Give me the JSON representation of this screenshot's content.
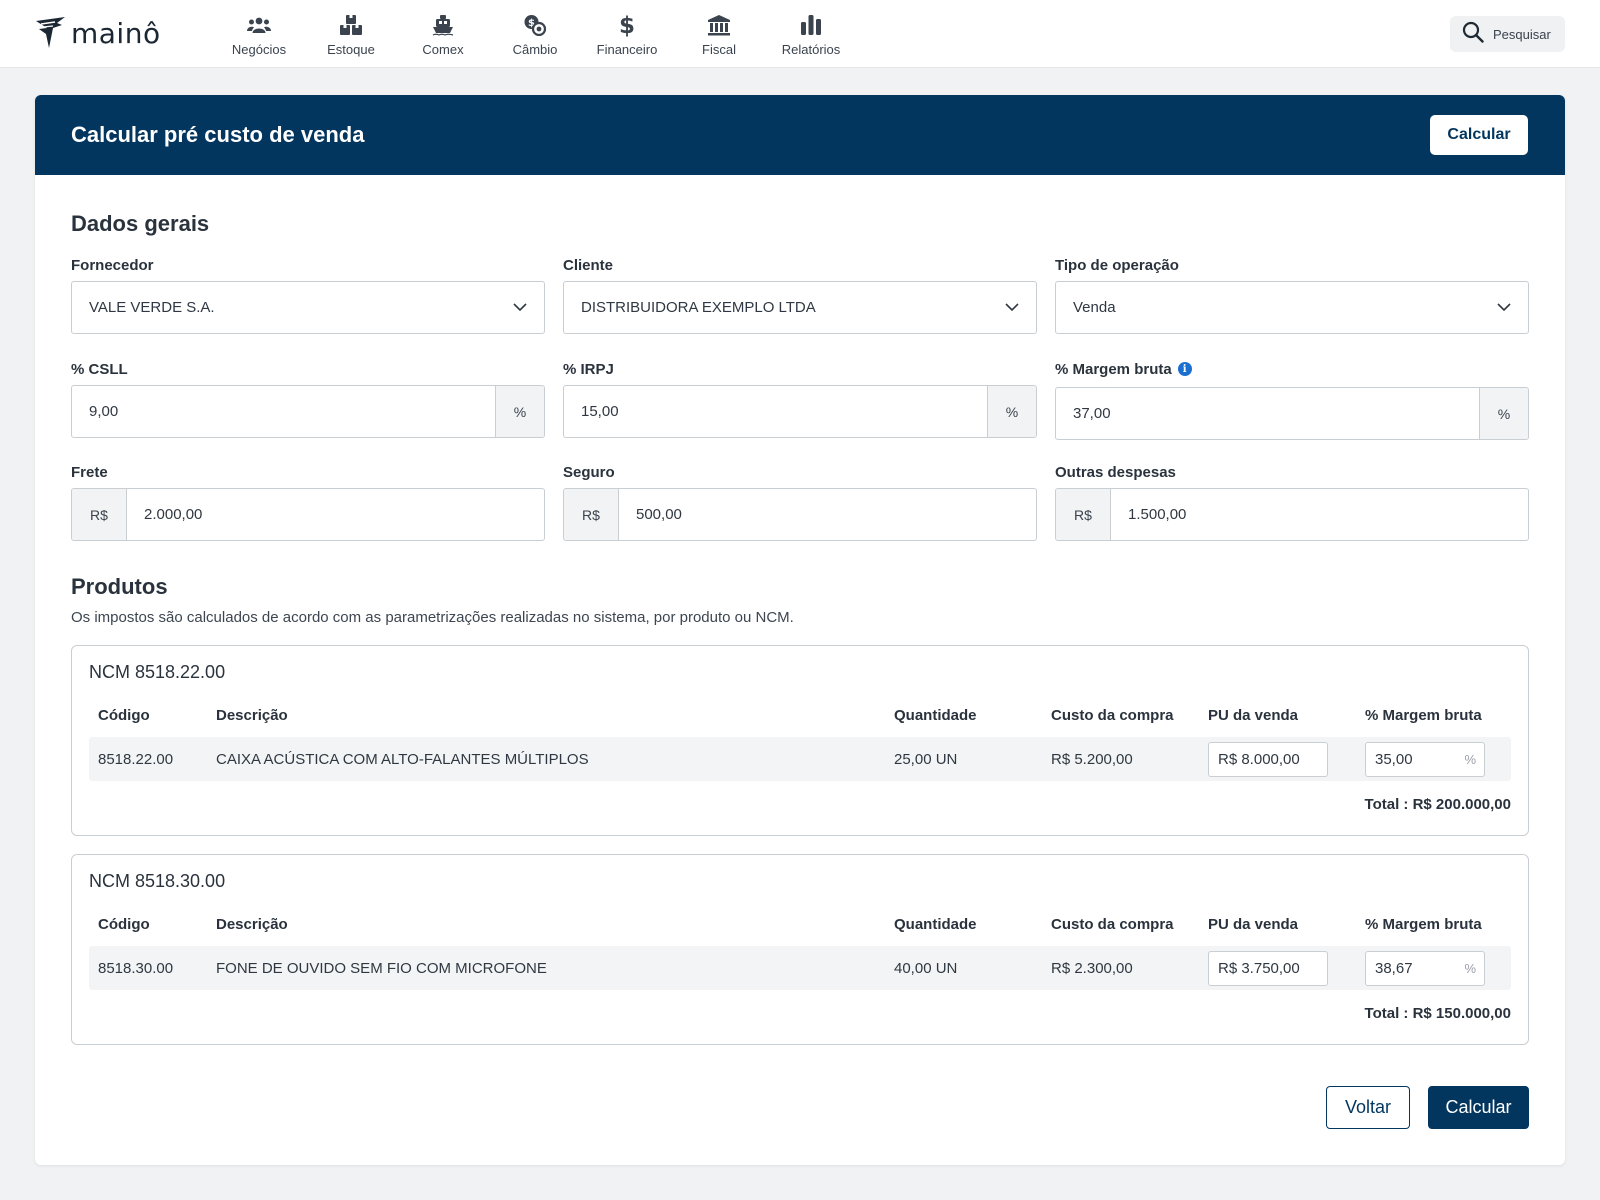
{
  "app": {
    "logo_text": "mainô"
  },
  "nav": {
    "items": [
      {
        "label": "Negócios",
        "icon": "users-icon"
      },
      {
        "label": "Estoque",
        "icon": "boxes-icon"
      },
      {
        "label": "Comex",
        "icon": "ship-icon"
      },
      {
        "label": "Câmbio",
        "icon": "coins-exchange-icon"
      },
      {
        "label": "Financeiro",
        "icon": "dollar-icon"
      },
      {
        "label": "Fiscal",
        "icon": "bank-icon"
      },
      {
        "label": "Relatórios",
        "icon": "bar-chart-icon"
      }
    ],
    "search_label": "Pesquisar"
  },
  "page": {
    "title": "Calcular pré custo de venda",
    "header_button": "Calcular"
  },
  "general": {
    "title": "Dados gerais",
    "fornecedor": {
      "label": "Fornecedor",
      "value": "VALE VERDE S.A."
    },
    "cliente": {
      "label": "Cliente",
      "value": "DISTRIBUIDORA EXEMPLO LTDA"
    },
    "tipo_operacao": {
      "label": "Tipo de operação",
      "value": "Venda"
    },
    "csll": {
      "label": "% CSLL",
      "value": "9,00",
      "unit": "%"
    },
    "irpj": {
      "label": "% IRPJ",
      "value": "15,00",
      "unit": "%"
    },
    "margem": {
      "label": "% Margem bruta",
      "value": "37,00",
      "unit": "%",
      "info": "i"
    },
    "frete": {
      "label": "Frete",
      "prefix": "R$",
      "value": "2.000,00"
    },
    "seguro": {
      "label": "Seguro",
      "prefix": "R$",
      "value": "500,00"
    },
    "outras": {
      "label": "Outras despesas",
      "prefix": "R$",
      "value": "1.500,00"
    }
  },
  "products": {
    "title": "Produtos",
    "note": "Os impostos são calculados de acordo com as parametrizações realizadas no sistema, por produto ou NCM.",
    "columns": [
      "Código",
      "Descrição",
      "Quantidade",
      "Custo da compra",
      "PU da venda",
      "% Margem bruta"
    ],
    "groups": [
      {
        "title": "NCM 8518.22.00",
        "row": {
          "codigo": "8518.22.00",
          "descricao": "CAIXA ACÚSTICA COM ALTO-FALANTES MÚLTIPLOS",
          "quantidade": "25,00 UN",
          "custo": "R$ 5.200,00",
          "pu_venda": "R$ 8.000,00",
          "margem": "35,00",
          "margem_unit": "%"
        },
        "total": "Total : R$ 200.000,00"
      },
      {
        "title": "NCM 8518.30.00",
        "row": {
          "codigo": "8518.30.00",
          "descricao": "FONE DE OUVIDO SEM FIO COM MICROFONE",
          "quantidade": "40,00 UN",
          "custo": "R$ 2.300,00",
          "pu_venda": "R$ 3.750,00",
          "margem": "38,67",
          "margem_unit": "%"
        },
        "total": "Total : R$ 150.000,00"
      }
    ]
  },
  "actions": {
    "back": "Voltar",
    "calculate": "Calcular"
  },
  "colors": {
    "primary": "#03365f",
    "info": "#1b6fd1",
    "background": "#f1f2f3"
  }
}
